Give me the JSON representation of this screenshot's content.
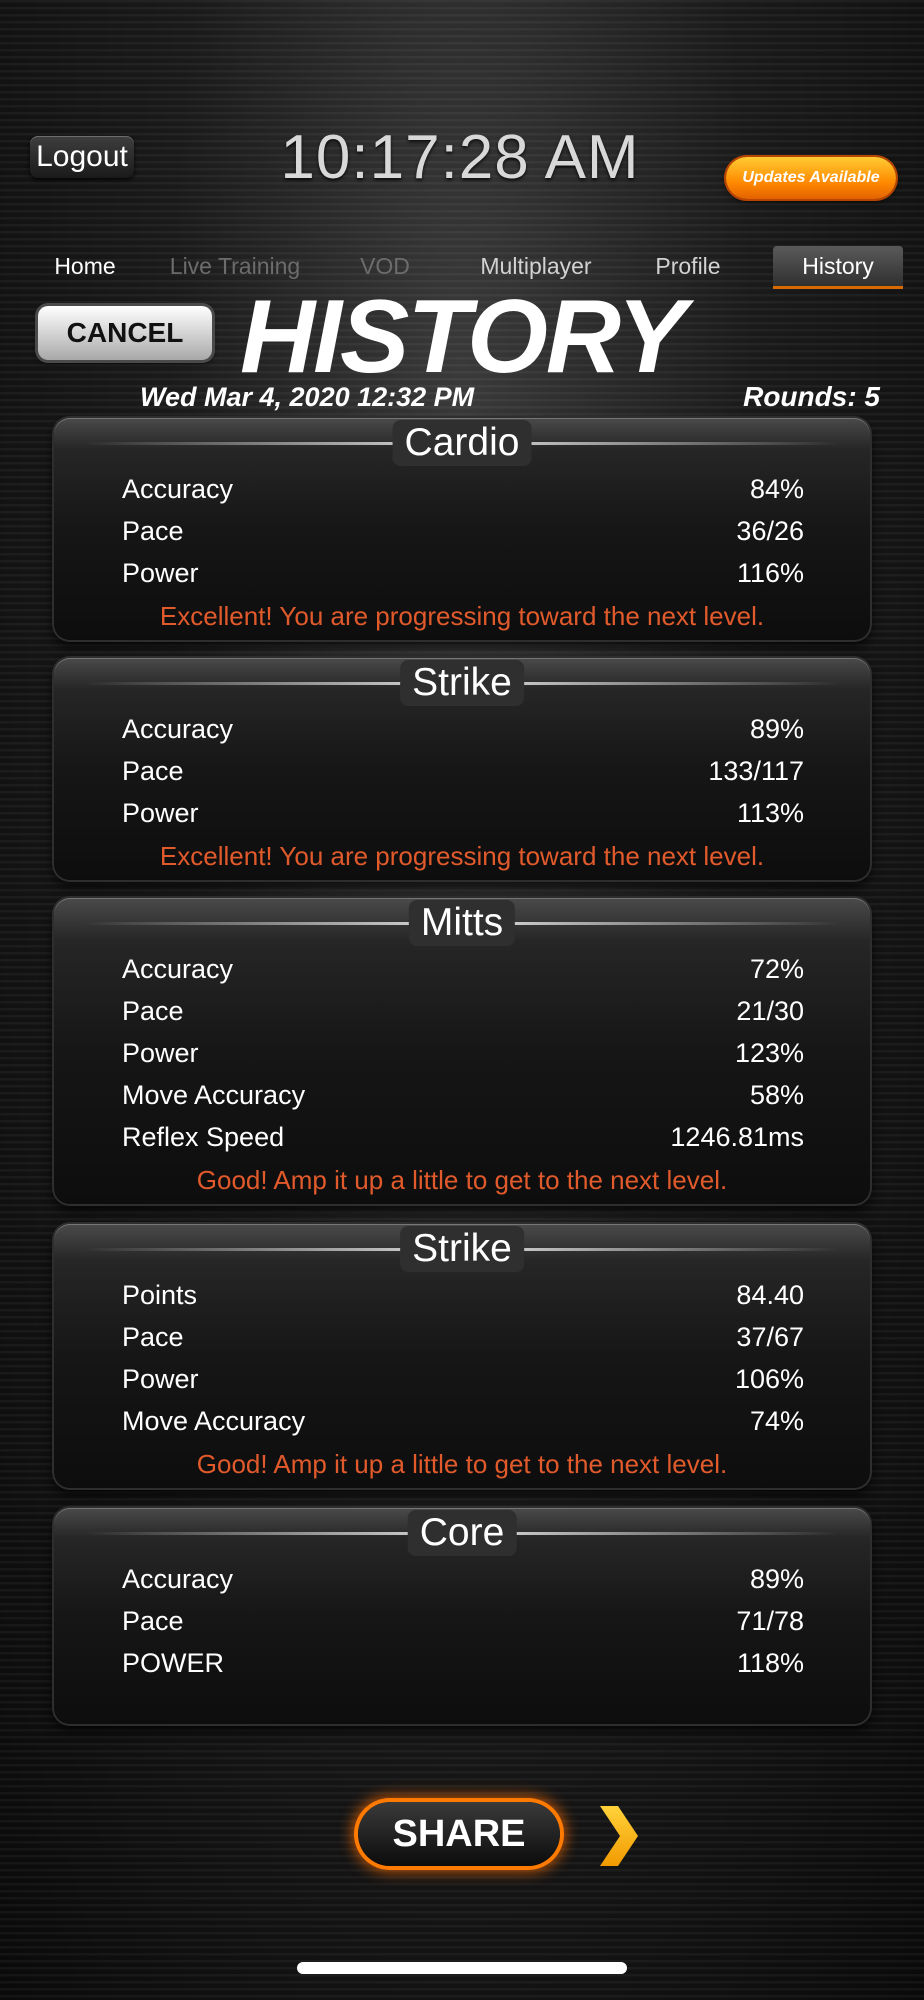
{
  "header": {
    "logout_label": "Logout",
    "clock": "10:17:28 AM",
    "updates_label": "Updates Available"
  },
  "tabs": [
    {
      "label": "Home"
    },
    {
      "label": "Live Training"
    },
    {
      "label": "VOD"
    },
    {
      "label": "Multiplayer"
    },
    {
      "label": "Profile"
    },
    {
      "label": "History"
    }
  ],
  "page": {
    "cancel_label": "CANCEL",
    "title": "HISTORY",
    "date": "Wed Mar 4, 2020 12:32 PM",
    "rounds": "Rounds: 5"
  },
  "cards": [
    {
      "title": "Cardio",
      "rows": [
        {
          "label": "Accuracy",
          "value": "84%"
        },
        {
          "label": "Pace",
          "value": "36/26"
        },
        {
          "label": "Power",
          "value": "116%"
        }
      ],
      "message": "Excellent! You are progressing toward the next level."
    },
    {
      "title": "Strike",
      "rows": [
        {
          "label": "Accuracy",
          "value": "89%"
        },
        {
          "label": "Pace",
          "value": "133/117"
        },
        {
          "label": "Power",
          "value": "113%"
        }
      ],
      "message": "Excellent! You are progressing toward the next level."
    },
    {
      "title": "Mitts",
      "rows": [
        {
          "label": "Accuracy",
          "value": "72%"
        },
        {
          "label": "Pace",
          "value": "21/30"
        },
        {
          "label": "Power",
          "value": "123%"
        },
        {
          "label": "Move Accuracy",
          "value": "58%"
        },
        {
          "label": "Reflex Speed",
          "value": "1246.81ms"
        }
      ],
      "message": "Good! Amp it up a little to get to the next level."
    },
    {
      "title": "Strike",
      "rows": [
        {
          "label": "Points",
          "value": "84.40"
        },
        {
          "label": "Pace",
          "value": "37/67"
        },
        {
          "label": "Power",
          "value": "106%"
        },
        {
          "label": "Move Accuracy",
          "value": "74%"
        }
      ],
      "message": "Good! Amp it up a little to get to the next level."
    },
    {
      "title": "Core",
      "rows": [
        {
          "label": "Accuracy",
          "value": "89%"
        },
        {
          "label": "Pace",
          "value": "71/78"
        },
        {
          "label": "POWER",
          "value": "118%"
        }
      ],
      "message": ""
    }
  ],
  "footer": {
    "share_label": "SHARE"
  },
  "colors": {
    "accent_orange": "#ff7a00",
    "message_red": "#e05a2b"
  },
  "icons": {
    "next": "chevron-right-icon"
  }
}
